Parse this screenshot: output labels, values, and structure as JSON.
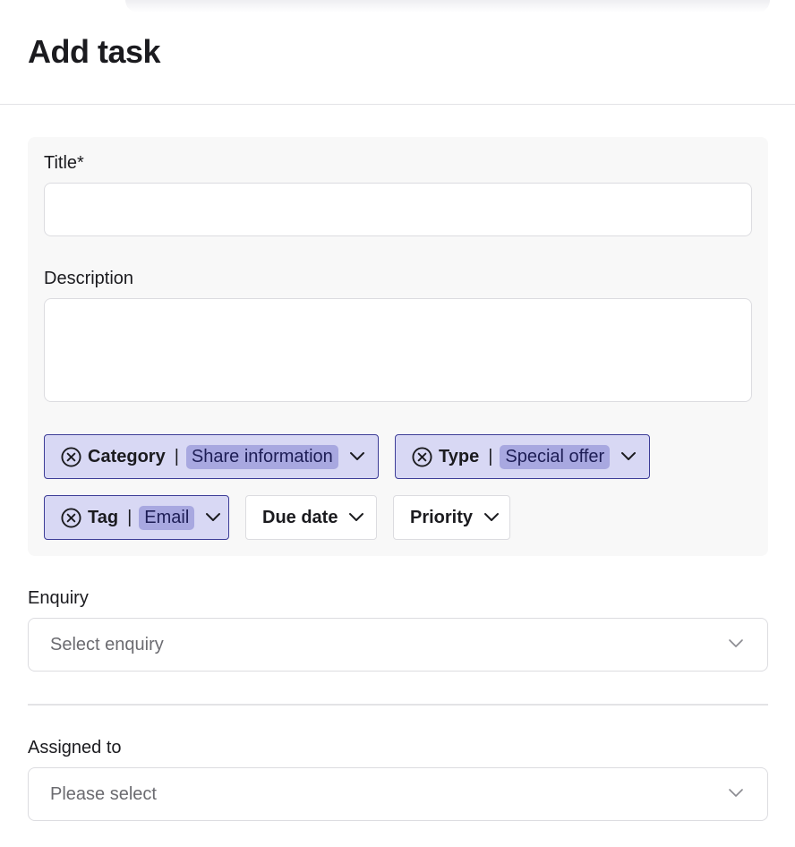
{
  "header": {
    "title": "Add task"
  },
  "form": {
    "title_label": "Title*",
    "title_value": "",
    "description_label": "Description",
    "description_value": "",
    "filters": {
      "category": {
        "name": "Category",
        "separator": "|",
        "value": "Share information"
      },
      "type": {
        "name": "Type",
        "separator": "|",
        "value": "Special offer"
      },
      "tag": {
        "name": "Tag",
        "separator": "|",
        "value": "Email"
      },
      "due_date": {
        "name": "Due date"
      },
      "priority": {
        "name": "Priority"
      }
    },
    "enquiry": {
      "label": "Enquiry",
      "placeholder": "Select enquiry"
    },
    "assigned_to": {
      "label": "Assigned to",
      "placeholder": "Please select"
    }
  },
  "colors": {
    "chip_active_bg": "#d8d8f4",
    "chip_active_border": "#3d3d97",
    "chip_value_bg": "#a8a8e0"
  }
}
